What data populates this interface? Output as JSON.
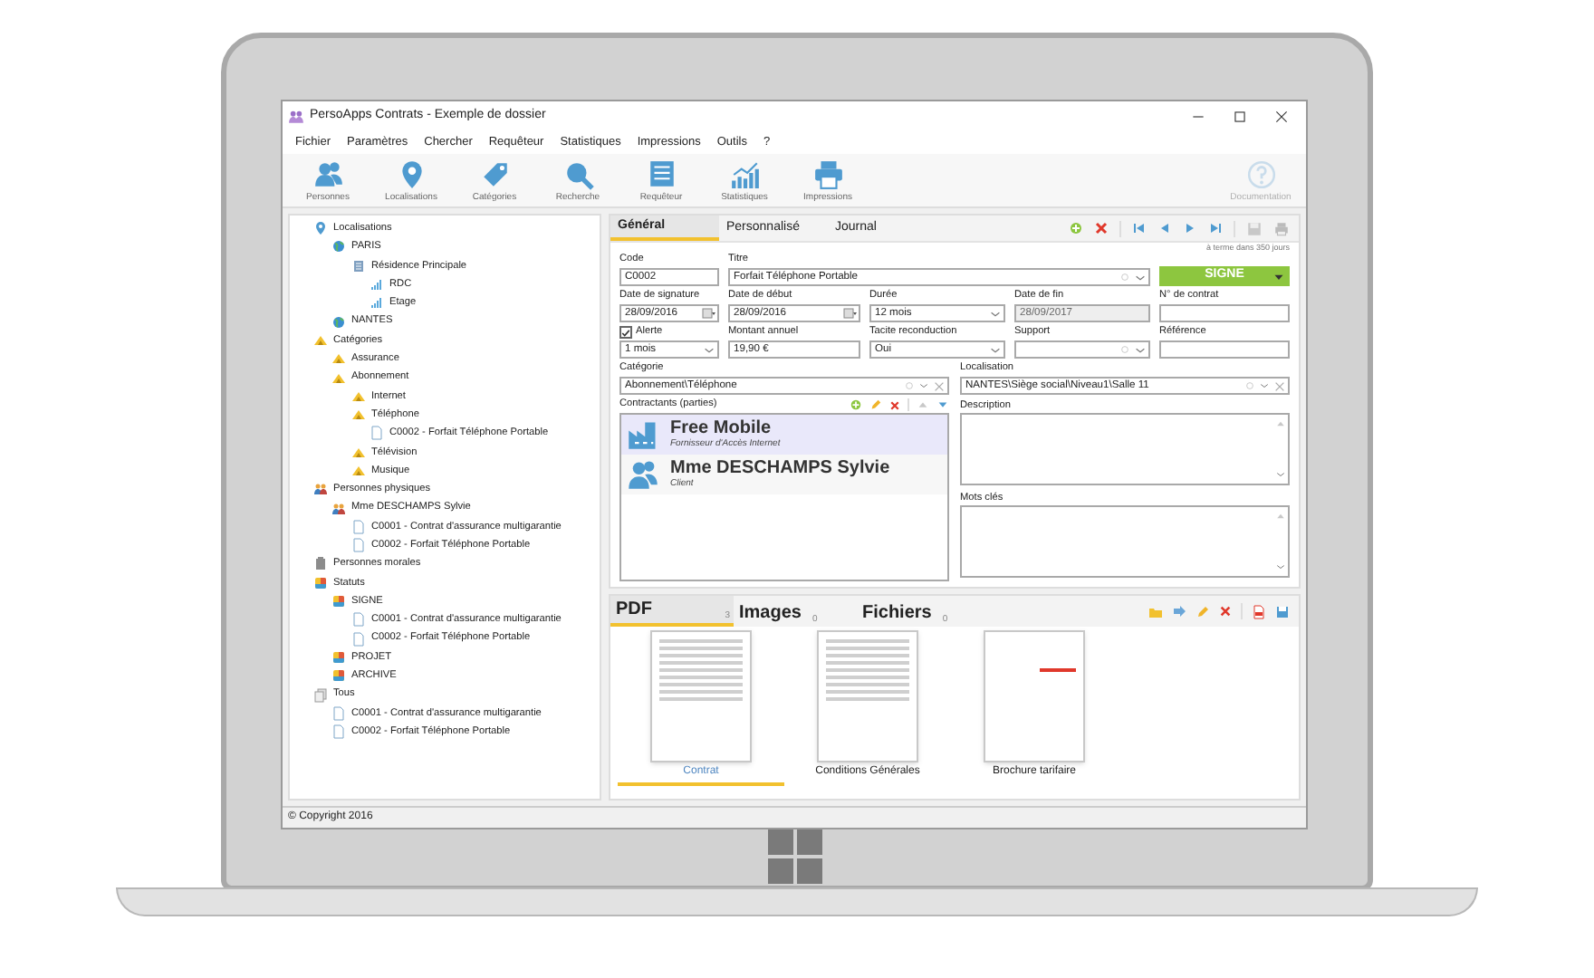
{
  "window": {
    "title": "PersoApps Contrats - Exemple de dossier"
  },
  "menu": [
    "Fichier",
    "Paramètres",
    "Chercher",
    "Requêteur",
    "Statistiques",
    "Impressions",
    "Outils",
    "?"
  ],
  "toolbar": [
    {
      "label": "Personnes",
      "kind": "people",
      "disabled": false
    },
    {
      "label": "Localisations",
      "kind": "pin",
      "disabled": false
    },
    {
      "label": "Catégories",
      "kind": "tag",
      "disabled": false
    },
    {
      "label": "Recherche",
      "kind": "search",
      "disabled": false
    },
    {
      "label": "Requêteur",
      "kind": "list",
      "disabled": false
    },
    {
      "label": "Statistiques",
      "kind": "chart",
      "disabled": false
    },
    {
      "label": "Impressions",
      "kind": "printer",
      "disabled": false
    },
    {
      "label": "Documentation",
      "kind": "help",
      "disabled": true
    }
  ],
  "tree": [
    {
      "label": "Localisations",
      "kind": "pin",
      "children": [
        {
          "label": "PARIS",
          "kind": "globe",
          "children": [
            {
              "label": "Résidence Principale",
              "kind": "building",
              "children": [
                {
                  "label": "RDC",
                  "kind": "floor"
                },
                {
                  "label": "Etage",
                  "kind": "floor"
                }
              ]
            }
          ]
        },
        {
          "label": "NANTES",
          "kind": "globe"
        }
      ]
    },
    {
      "label": "Catégories",
      "kind": "category",
      "children": [
        {
          "label": "Assurance",
          "kind": "category"
        },
        {
          "label": "Abonnement",
          "kind": "category",
          "children": [
            {
              "label": "Internet",
              "kind": "category"
            },
            {
              "label": "Téléphone",
              "kind": "category",
              "children": [
                {
                  "label": "C0002 - Forfait Téléphone Portable",
                  "kind": "file"
                }
              ]
            },
            {
              "label": "Télévision",
              "kind": "category"
            },
            {
              "label": "Musique",
              "kind": "category"
            }
          ]
        }
      ]
    },
    {
      "label": "Personnes physiques",
      "kind": "persons",
      "children": [
        {
          "label": "Mme DESCHAMPS Sylvie",
          "kind": "persons",
          "children": [
            {
              "label": "C0001 - Contrat d'assurance multigarantie",
              "kind": "file"
            },
            {
              "label": "C0002 - Forfait Téléphone Portable",
              "kind": "file"
            }
          ]
        }
      ]
    },
    {
      "label": "Personnes morales",
      "kind": "company"
    },
    {
      "label": "Statuts",
      "kind": "status",
      "children": [
        {
          "label": "SIGNE",
          "kind": "status",
          "children": [
            {
              "label": "C0001 - Contrat d'assurance multigarantie",
              "kind": "file"
            },
            {
              "label": "C0002 - Forfait Téléphone Portable",
              "kind": "file"
            }
          ]
        },
        {
          "label": "PROJET",
          "kind": "status"
        },
        {
          "label": "ARCHIVE",
          "kind": "status"
        }
      ]
    },
    {
      "label": "Tous",
      "kind": "all",
      "children": [
        {
          "label": "C0001 - Contrat d'assurance multigarantie",
          "kind": "file"
        },
        {
          "label": "C0002 - Forfait Téléphone Portable",
          "kind": "file"
        }
      ]
    }
  ],
  "tabs": [
    {
      "label": "Général",
      "selected": true
    },
    {
      "label": "Personnalisé",
      "selected": false
    },
    {
      "label": "Journal",
      "selected": false
    }
  ],
  "due_note": "à terme dans 350 jours",
  "status_button": {
    "label": "SIGNE"
  },
  "fields": [
    {
      "label": "Code",
      "value": "C0002",
      "kind": "text",
      "disabled": false
    },
    {
      "label": "Titre",
      "value": "Forfait Téléphone Portable",
      "kind": "combo",
      "disabled": false
    },
    {
      "label": "Date de signature",
      "value": "28/09/2016",
      "kind": "date",
      "disabled": false
    },
    {
      "label": "Date de début",
      "value": "28/09/2016",
      "kind": "date",
      "disabled": false
    },
    {
      "label": "Durée",
      "value": "12 mois",
      "kind": "select",
      "disabled": false
    },
    {
      "label": "Date de fin",
      "value": "28/09/2017",
      "kind": "text",
      "disabled": true
    },
    {
      "label": "N° de contrat",
      "kind": "text",
      "disabled": false
    },
    {
      "label": "Alerte",
      "value": "1 mois",
      "kind": "check_select",
      "checked": true,
      "disabled": false
    },
    {
      "label": "Montant annuel",
      "value": "19,90 €",
      "kind": "text",
      "disabled": false
    },
    {
      "label": "Tacite reconduction",
      "value": "Oui",
      "kind": "select",
      "disabled": false
    },
    {
      "label": "Support",
      "kind": "combo",
      "disabled": false
    },
    {
      "label": "Référence",
      "kind": "text",
      "disabled": false
    },
    {
      "label": "Catégorie",
      "value": "Abonnement\\Téléphone",
      "kind": "picker",
      "disabled": false
    },
    {
      "label": "Localisation",
      "value": "NANTES\\Siège social\\Niveau1\\Salle 11",
      "kind": "picker",
      "disabled": false
    }
  ],
  "parties": {
    "label": "Contractants (parties)",
    "items": [
      {
        "name": "Free Mobile",
        "role": "Fornisseur d'Accès Internet",
        "kind": "company",
        "selected": true
      },
      {
        "name": "Mme DESCHAMPS Sylvie",
        "role": "Client",
        "kind": "person",
        "selected": false
      }
    ]
  },
  "description": {
    "label": "Description"
  },
  "keywords": {
    "label": "Mots clés"
  },
  "doc_tabs": [
    {
      "label": "PDF",
      "count": "3",
      "selected": true
    },
    {
      "label": "Images",
      "count": "0",
      "selected": false
    },
    {
      "label": "Fichiers",
      "count": "0",
      "selected": false
    }
  ],
  "documents": [
    {
      "caption": "Contrat",
      "selected": true
    },
    {
      "caption": "Conditions Générales",
      "selected": false
    },
    {
      "caption": "Brochure tarifaire",
      "selected": false
    }
  ],
  "status_bar": "© Copyright 2016"
}
